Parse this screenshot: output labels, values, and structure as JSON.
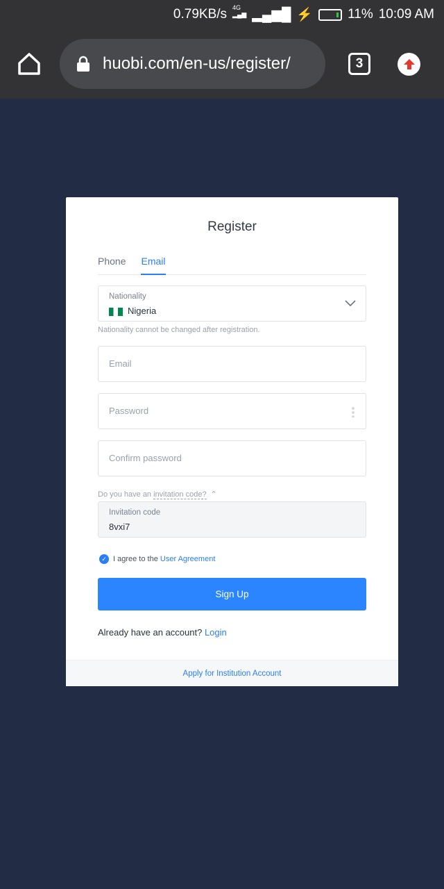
{
  "status_bar": {
    "speed": "0.79KB/s",
    "network": "4G",
    "battery": "11%",
    "time": "10:09 AM"
  },
  "browser": {
    "url": "huobi.com/en-us/register/",
    "tab_count": "3"
  },
  "card": {
    "title": "Register",
    "tabs": [
      {
        "label": "Phone"
      },
      {
        "label": "Email",
        "active": true
      }
    ],
    "nationality": {
      "label": "Nationality",
      "value": "Nigeria",
      "hint": "Nationality cannot be changed after registration."
    },
    "email_placeholder": "Email",
    "password_placeholder": "Password",
    "confirm_placeholder": "Confirm password",
    "invitation_question": "Do you have an ",
    "invitation_link": "invitation code?",
    "invitation": {
      "label": "Invitation code",
      "value": "8vxi7"
    },
    "agree_text": "I agree to the ",
    "agree_link": "User Agreement",
    "agree_checked": true,
    "signup_label": "Sign Up",
    "have_account": "Already have an account? ",
    "login_link": "Login",
    "institution_link": "Apply for Institution Account"
  },
  "colors": {
    "accent": "#2a85ff",
    "background": "#232c45"
  }
}
